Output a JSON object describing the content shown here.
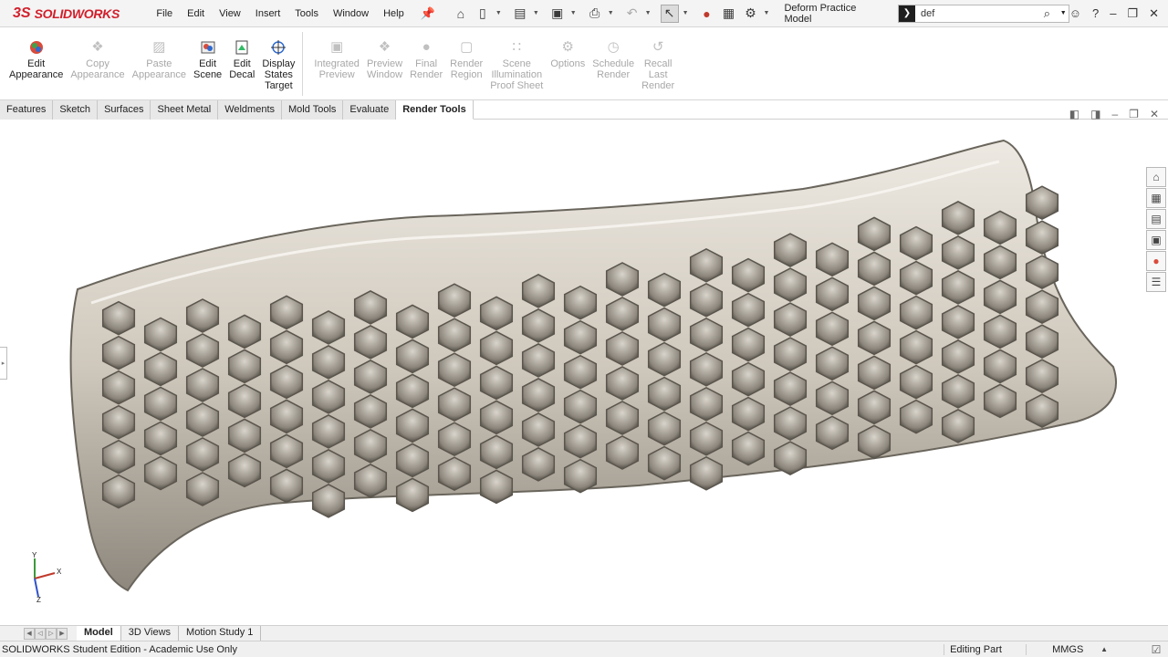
{
  "app": {
    "logo_mark": "3S",
    "logo_text": "SOLIDWORKS",
    "document_title": "Deform Practice Model"
  },
  "menu": [
    "File",
    "Edit",
    "View",
    "Insert",
    "Tools",
    "Window",
    "Help"
  ],
  "search": {
    "value": "def"
  },
  "command_manager": {
    "buttons": [
      {
        "label1": "Edit",
        "label2": "Appearance",
        "label3": "",
        "enabled": true,
        "icon": "appearance-icon"
      },
      {
        "label1": "Copy",
        "label2": "Appearance",
        "label3": "",
        "enabled": false,
        "icon": "copy-appearance-icon"
      },
      {
        "label1": "Paste",
        "label2": "Appearance",
        "label3": "",
        "enabled": false,
        "icon": "paste-appearance-icon"
      },
      {
        "label1": "Edit",
        "label2": "Scene",
        "label3": "",
        "enabled": true,
        "icon": "scene-icon"
      },
      {
        "label1": "Edit",
        "label2": "Decal",
        "label3": "",
        "enabled": true,
        "icon": "decal-icon"
      },
      {
        "label1": "Display",
        "label2": "States",
        "label3": "Target",
        "enabled": true,
        "icon": "target-icon"
      }
    ],
    "render_buttons": [
      {
        "label1": "Integrated",
        "label2": "Preview",
        "label3": "",
        "enabled": false
      },
      {
        "label1": "Preview",
        "label2": "Window",
        "label3": "",
        "enabled": false
      },
      {
        "label1": "Final",
        "label2": "Render",
        "label3": "",
        "enabled": false
      },
      {
        "label1": "Render",
        "label2": "Region",
        "label3": "",
        "enabled": false
      },
      {
        "label1": "Scene",
        "label2": "Illumination",
        "label3": "Proof Sheet",
        "enabled": false
      },
      {
        "label1": "Options",
        "label2": "",
        "label3": "",
        "enabled": false
      },
      {
        "label1": "Schedule",
        "label2": "Render",
        "label3": "",
        "enabled": false
      },
      {
        "label1": "Recall",
        "label2": "Last",
        "label3": "Render",
        "enabled": false
      }
    ]
  },
  "tabs": [
    "Features",
    "Sketch",
    "Surfaces",
    "Sheet Metal",
    "Weldments",
    "Mold Tools",
    "Evaluate",
    "Render Tools"
  ],
  "active_tab": "Render Tools",
  "triad": {
    "y": "Y",
    "x": "X",
    "z": "Z"
  },
  "bottom_tabs": [
    "Model",
    "3D Views",
    "Motion Study 1"
  ],
  "status": {
    "edition": "SOLIDWORKS Student Edition - Academic Use Only",
    "mode": "Editing Part",
    "units": "MMGS"
  },
  "colors": {
    "brand": "#d21f2b",
    "part": "#c8c0b4"
  }
}
